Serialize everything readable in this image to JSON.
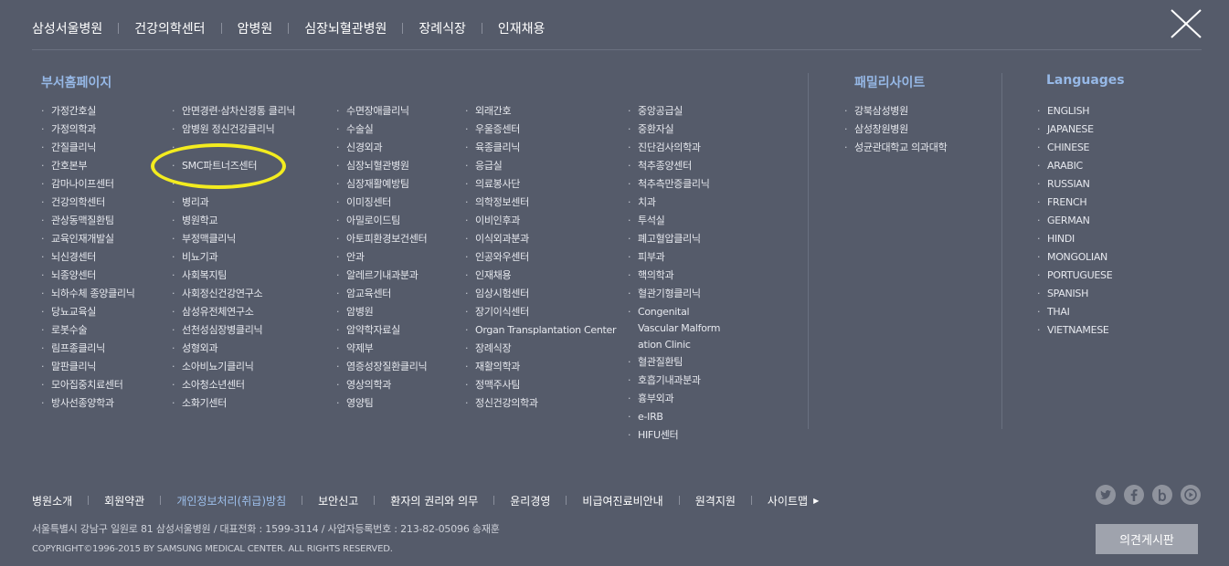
{
  "topnav": [
    "삼성서울병원",
    "건강의학센터",
    "암병원",
    "심장뇌혈관병원",
    "장례식장",
    "인재채용"
  ],
  "sections": {
    "dept_title": "부서홈페이지",
    "family_title": "패밀리사이트",
    "lang_title": "Languages"
  },
  "dept_columns": [
    [
      "가정간호실",
      "가정의학과",
      "간질클리닉",
      "간호본부",
      "감마나이프센터",
      "건강의학센터",
      "관상동맥질환팀",
      "교육인재개발실",
      "뇌신경센터",
      "뇌종양센터",
      "뇌하수체 종양클리닉",
      "당뇨교육실",
      "로봇수술",
      "림프종클리닉",
      "말판클리닉",
      "모아집중치료센터",
      "방사선종양학과"
    ],
    [
      "안면경련·삼차신경통 클리닉",
      "암병원 정신건강클리닉",
      "",
      "SMC파트너즈센터",
      "",
      "병리과",
      "병원학교",
      "부정맥클리닉",
      "비뇨기과",
      "사회복지팀",
      "사회정신건강연구소",
      "삼성유전체연구소",
      "선천성심장병클리닉",
      "성형외과",
      "소아비뇨기클리닉",
      "소아청소년센터",
      "소화기센터"
    ],
    [
      "수면장애클리닉",
      "수술실",
      "신경외과",
      "심장뇌혈관병원",
      "심장재활예방팀",
      "이미징센터",
      "아밀로이드팀",
      "아토피환경보건센터",
      "안과",
      "알레르기내과분과",
      "암교육센터",
      "암병원",
      "암약학자료실",
      "약제부",
      "염증성장질환클리닉",
      "영상의학과",
      "영양팀"
    ],
    [
      "외래간호",
      "우울증센터",
      "육종클리닉",
      "응급실",
      "의료봉사단",
      "의학정보센터",
      "이비인후과",
      "이식외과분과",
      "인공와우센터",
      "인재채용",
      "임상시험센터",
      "장기이식센터",
      "Organ Transplantation Center",
      "장례식장",
      "재활의학과",
      "정맥주사팀",
      "정신건강의학과"
    ],
    [
      "중앙공급실",
      "중환자실",
      "진단검사의학과",
      "척추종양센터",
      "척추측만증클리닉",
      "치과",
      "투석실",
      "폐고혈압클리닉",
      "피부과",
      "핵의학과",
      "혈관기형클리닉",
      "Congenital Vascular Malform ation Clinic",
      "혈관질환팀",
      "호흡기내과분과",
      "흉부외과",
      "e-IRB",
      "HIFU센터"
    ]
  ],
  "family_sites": [
    "강북삼성병원",
    "삼성창원병원",
    "성균관대학교 의과대학"
  ],
  "languages": [
    "ENGLISH",
    "JAPANESE",
    "CHINESE",
    "ARABIC",
    "RUSSIAN",
    "FRENCH",
    "GERMAN",
    "HINDI",
    "MONGOLIAN",
    "PORTUGUESE",
    "SPANISH",
    "THAI",
    "VIETNAMESE"
  ],
  "footer": {
    "links": [
      "병원소개",
      "회원약관",
      "개인정보처리(취급)방침",
      "보안신고",
      "환자의 권리와 의무",
      "윤리경영",
      "비급여진료비안내",
      "원격지원",
      "사이트맵"
    ],
    "address": "서울특별시 강남구 일원로 81 삼성서울병원 / 대표전화 : 1599-3114 / 사업자등록번호 : 213-82-05096 송재훈",
    "copyright": "COPYRIGHT©1996-2015 BY SAMSUNG MEDICAL CENTER. ALL RIGHTS RESERVED.",
    "opinion_button": "의견게시판"
  },
  "social_icons": [
    "twitter-icon",
    "facebook-icon",
    "blog-icon",
    "youtube-icon"
  ],
  "colors": {
    "background": "#555b6a",
    "section_title": "#96b8e6",
    "privacy_link": "#9ec0ec",
    "highlight_ellipse": "#f3ec1f",
    "opinion_button": "#9fa3ad"
  }
}
